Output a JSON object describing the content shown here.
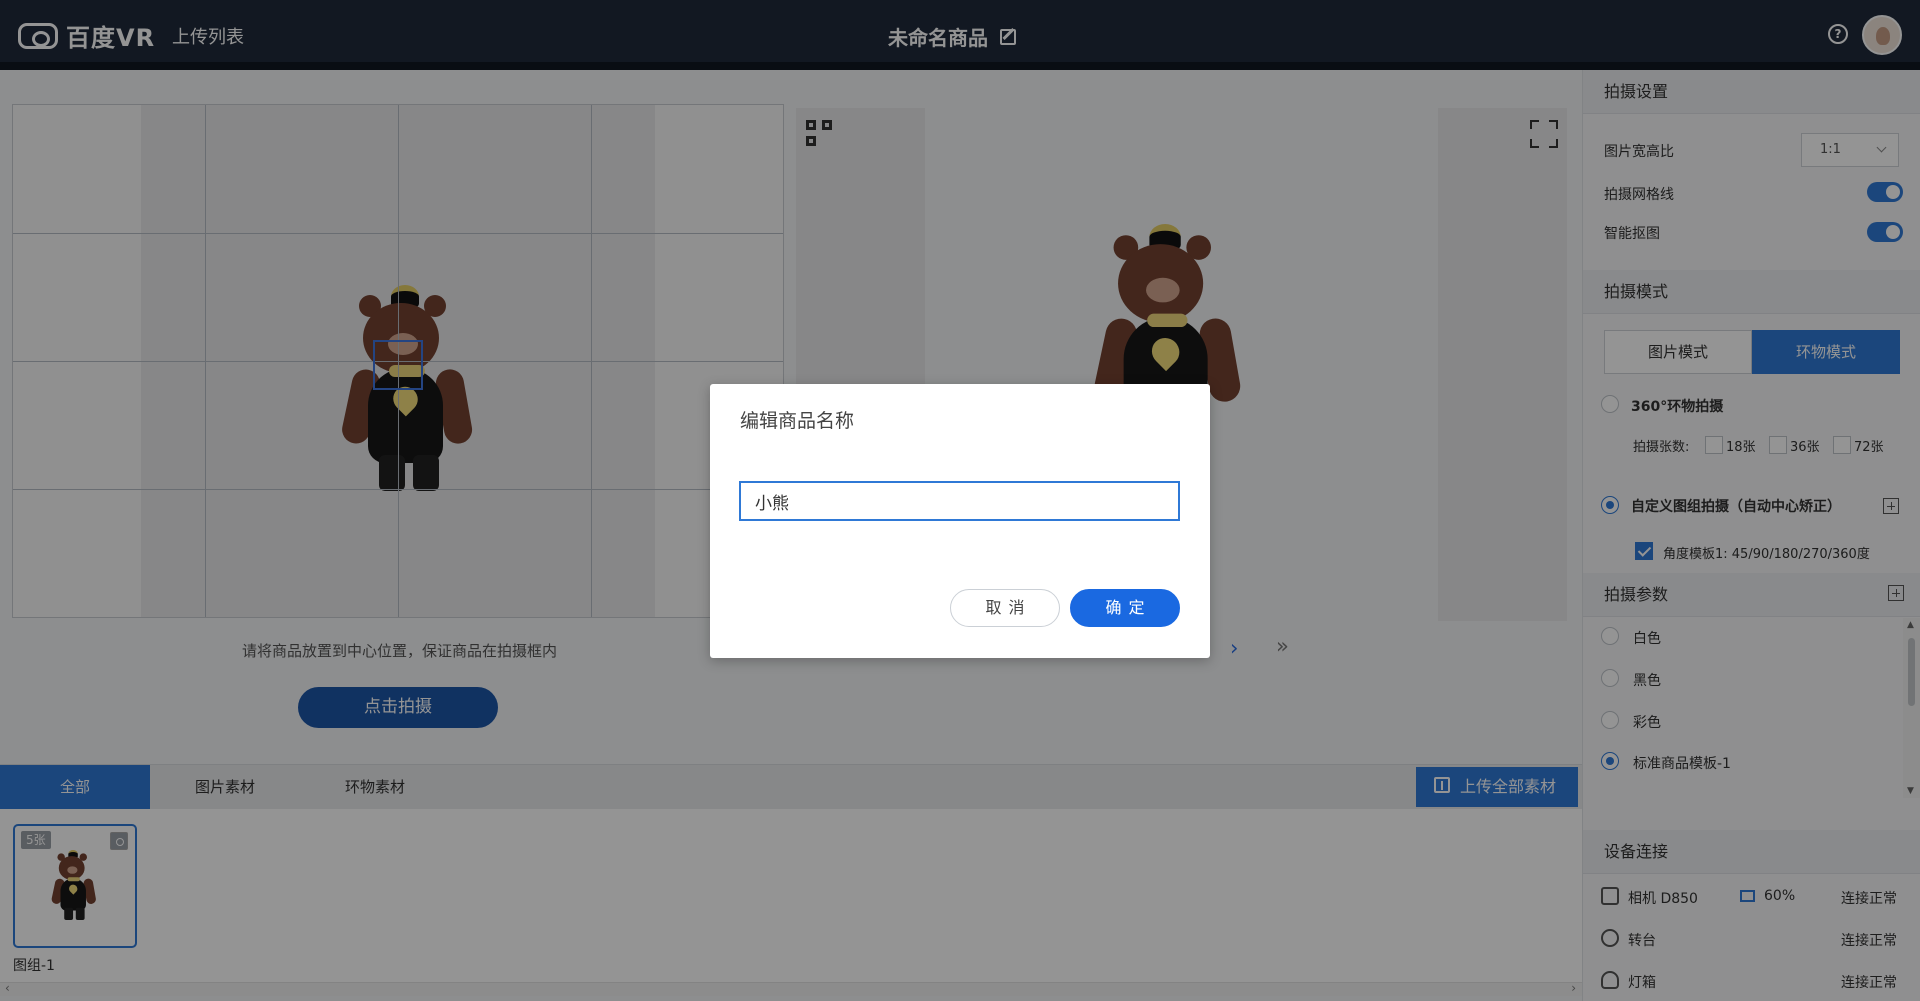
{
  "app": {
    "logo_text": "百度VR",
    "nav_upload_list": "上传列表",
    "product_title": "未命名商品",
    "help_symbol": "?"
  },
  "capture": {
    "tip": "请将商品放置到中心位置，保证商品在拍摄框内",
    "button": "点击拍摄"
  },
  "preview": {
    "next_symbol": "›",
    "last_symbol": "»"
  },
  "tabs": [
    {
      "label": "全部",
      "active": true
    },
    {
      "label": "图片素材",
      "active": false
    },
    {
      "label": "环物素材",
      "active": false
    }
  ],
  "upload_all": "上传全部素材",
  "materials": [
    {
      "name": "图组-1",
      "count": "5张"
    }
  ],
  "settings": {
    "shoot_settings_title": "拍摄设置",
    "aspect_ratio_label": "图片宽高比",
    "aspect_ratio_value": "1:1",
    "grid_lines_label": "拍摄网格线",
    "smart_cutout_label": "智能抠图",
    "shoot_mode_title": "拍摄模式",
    "mode_image": "图片模式",
    "mode_rotation": "环物模式",
    "option_360": "360°环物拍摄",
    "shot_count_label": "拍摄张数:",
    "shot_counts": [
      "18张",
      "36张",
      "72张"
    ],
    "custom_group": "自定义图组拍摄（自动中心矫正）",
    "angle_template": "角度模板1: 45/90/180/270/360度",
    "params_title": "拍摄参数",
    "params": [
      "白色",
      "黑色",
      "彩色",
      "标准商品模板-1"
    ],
    "device_title": "设备连接",
    "devices": [
      {
        "name": "相机 D850",
        "battery": "60%",
        "status": "连接正常"
      },
      {
        "name": "转台",
        "status": "连接正常"
      },
      {
        "name": "灯箱",
        "status": "连接正常"
      }
    ]
  },
  "modal": {
    "title": "编辑商品名称",
    "input_value": "小熊",
    "cancel": "取消",
    "confirm": "确定"
  },
  "colors": {
    "header": "#1f2a3c",
    "accent": "#2f79d6",
    "primary_button": "#1a69e1"
  }
}
